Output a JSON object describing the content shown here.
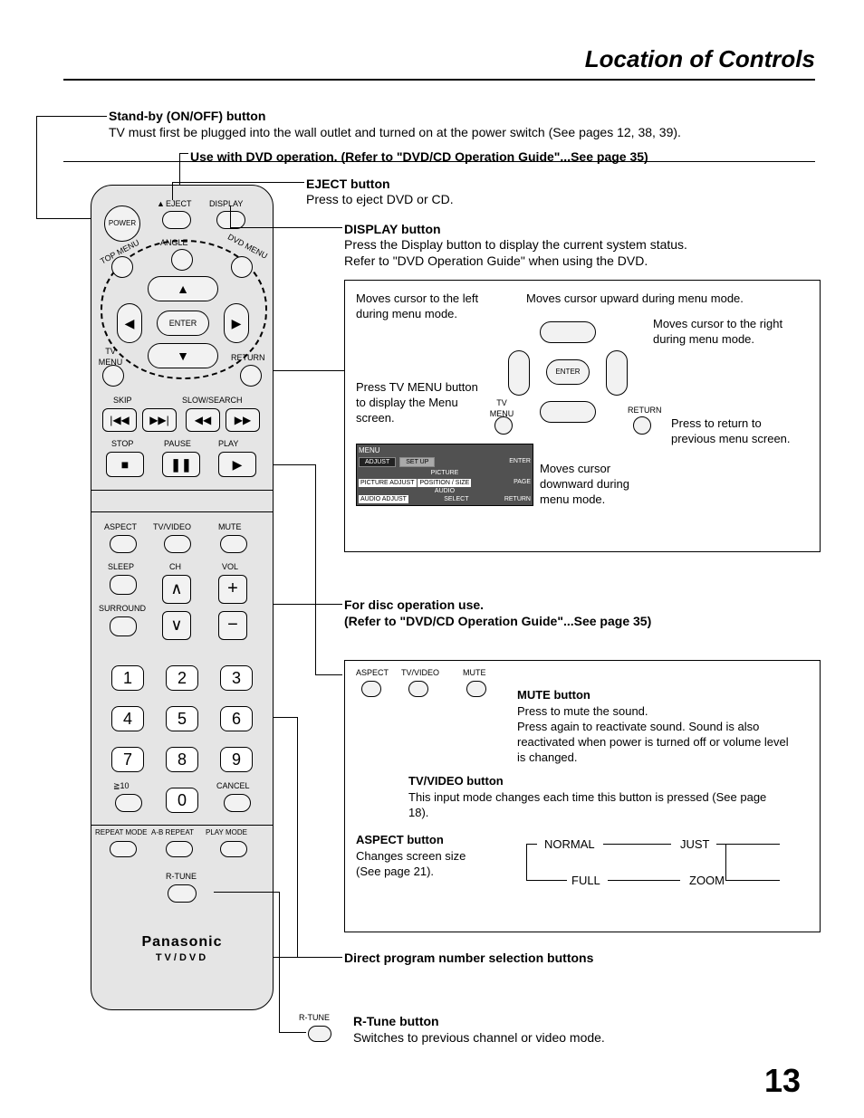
{
  "page": {
    "title": "Location of Controls",
    "number": "13"
  },
  "standby": {
    "heading": "Stand-by (ON/OFF) button",
    "text": "TV must first be plugged into the wall outlet and turned on at the power switch (See pages 12, 38, 39)."
  },
  "dvdNote": "Use with DVD operation. (Refer to \"DVD/CD Operation Guide\"...See page 35)",
  "eject": {
    "heading": "EJECT button",
    "text": "Press to eject DVD or CD."
  },
  "display": {
    "heading": "DISPLAY button",
    "text1": "Press the Display button to display the current system status.",
    "text2": "Refer to \"DVD Operation Guide\" when using the DVD."
  },
  "cursorBox": {
    "upLeft": "Moves cursor to the left during menu mode.",
    "upRight": "Moves cursor upward during menu mode.",
    "right": "Moves cursor to the right during menu mode.",
    "tvMenu": "Press TV MENU button to display the Menu screen.",
    "return": "Press to return to previous menu screen.",
    "down": "Moves cursor downward during menu mode.",
    "enter": "ENTER",
    "tvMenuLabel": "TV MENU",
    "returnLabel": "RETURN",
    "menuPopup": {
      "menu": "MENU",
      "adjust": "ADJUST",
      "setup": "SET UP",
      "picture": "PICTURE",
      "pictureAdjust": "PICTURE ADJUST",
      "positionSize": "POSITION / SIZE",
      "audio": "AUDIO",
      "audioAdjust": "AUDIO ADJUST",
      "enter": "ENTER",
      "page": "PAGE",
      "select": "SELECT",
      "ret": "RETURN"
    }
  },
  "discNote": {
    "line1": "For disc operation use.",
    "line2": "(Refer to \"DVD/CD Operation Guide\"...See page 35)"
  },
  "aspectBox": {
    "smallLabels": {
      "aspect": "ASPECT",
      "tvvideo": "TV/VIDEO",
      "mute": "MUTE"
    },
    "mute": {
      "heading": "MUTE button",
      "l1": "Press to mute the sound.",
      "l2": "Press again to reactivate sound. Sound is also reactivated when power is turned off or volume level is changed."
    },
    "tvvideo": {
      "heading": "TV/VIDEO button",
      "text": "This input mode changes each time this button is pressed (See page 18)."
    },
    "aspect": {
      "heading": "ASPECT button",
      "l1": "Changes screen size",
      "l2": "(See page 21)."
    },
    "cycle": {
      "normal": "NORMAL",
      "just": "JUST",
      "full": "FULL",
      "zoom": "ZOOM"
    }
  },
  "direct": "Direct program number selection buttons",
  "rtune": {
    "small": "R-TUNE",
    "heading": "R-Tune button",
    "text": "Switches to previous channel or video mode."
  },
  "remote": {
    "power": "POWER",
    "eject": "EJECT",
    "display": "DISPLAY",
    "topMenu": "TOP MENU",
    "angle": "ANGLE",
    "dvdMenu": "DVD MENU",
    "enter": "ENTER",
    "tvMenu": "TV MENU",
    "return": "RETURN",
    "skip": "SKIP",
    "slowSearch": "SLOW/SEARCH",
    "stop": "STOP",
    "pause": "PAUSE",
    "play": "PLAY",
    "aspect": "ASPECT",
    "tvvideo": "TV/VIDEO",
    "mute": "MUTE",
    "sleep": "SLEEP",
    "ch": "CH",
    "vol": "VOL",
    "surround": "SURROUND",
    "gte10": "≧10",
    "cancel": "CANCEL",
    "repeatMode": "REPEAT MODE",
    "abRepeat": "A-B REPEAT",
    "playMode": "PLAY MODE",
    "rtune": "R-TUNE",
    "brand": "Panasonic",
    "sub": "TV/DVD",
    "nums": [
      "1",
      "2",
      "3",
      "4",
      "5",
      "6",
      "7",
      "8",
      "9",
      "0"
    ]
  }
}
